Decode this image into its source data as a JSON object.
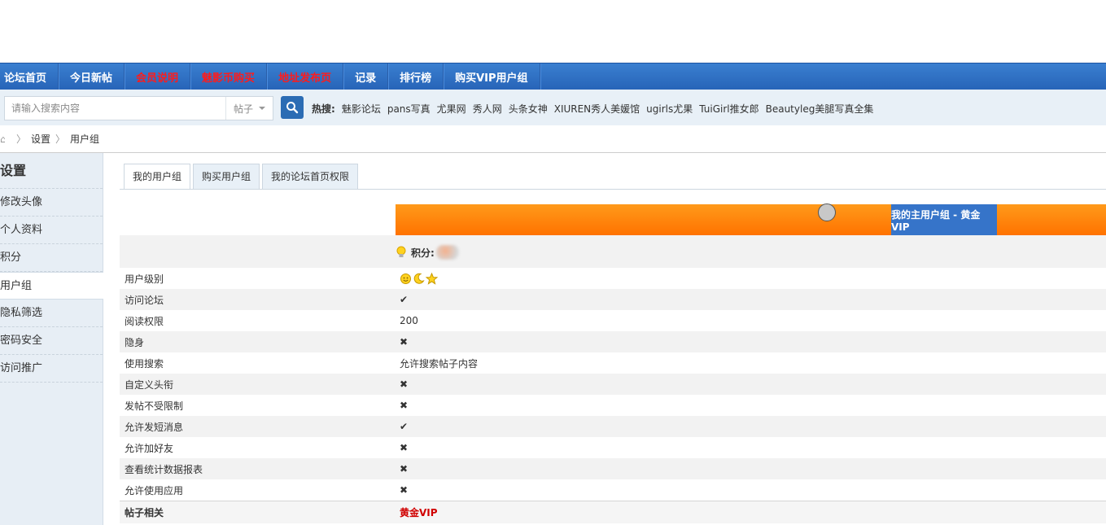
{
  "nav": {
    "items": [
      {
        "label": "论坛首页",
        "red": false
      },
      {
        "label": "今日新帖",
        "red": false
      },
      {
        "label": "会员说明",
        "red": true
      },
      {
        "label": "魅影币购买",
        "red": true
      },
      {
        "label": "地址发布页",
        "red": true
      },
      {
        "label": "记录",
        "red": false
      },
      {
        "label": "排行榜",
        "red": false
      },
      {
        "label": "购买VIP用户组",
        "red": false
      }
    ]
  },
  "search": {
    "placeholder": "请输入搜索内容",
    "type": "帖子",
    "hot_label": "热搜:",
    "hot_items": [
      "魅影论坛",
      "pans写真",
      "尤果网",
      "秀人网",
      "头条女神",
      "XIUREN秀人美媛馆",
      "ugirls尤果",
      "TuiGirl推女郎",
      "Beautyleg美腿写真全集"
    ]
  },
  "breadcrumb": {
    "items": [
      "设置",
      "用户组"
    ]
  },
  "sidebar": {
    "title": "设置",
    "items": [
      "修改头像",
      "个人资料",
      "积分",
      "用户组",
      "隐私筛选",
      "密码安全",
      "访问推广"
    ],
    "active_index": 3
  },
  "tabs": [
    "我的用户组",
    "购买用户组",
    "我的论坛首页权限"
  ],
  "group": {
    "name": "我的主用户组 - 黄金VIP",
    "score_label": "积分:"
  },
  "permissions": [
    {
      "label": "用户级别",
      "value": "",
      "type": "level"
    },
    {
      "label": "访问论坛",
      "value": "",
      "type": "yes"
    },
    {
      "label": "阅读权限",
      "value": "200",
      "type": "text"
    },
    {
      "label": "隐身",
      "value": "",
      "type": "no"
    },
    {
      "label": "使用搜索",
      "value": "允许搜索帖子内容",
      "type": "text"
    },
    {
      "label": "自定义头衔",
      "value": "",
      "type": "no"
    },
    {
      "label": "发帖不受限制",
      "value": "",
      "type": "no"
    },
    {
      "label": "允许发短消息",
      "value": "",
      "type": "yes"
    },
    {
      "label": "允许加好友",
      "value": "",
      "type": "no"
    },
    {
      "label": "查看统计数据报表",
      "value": "",
      "type": "no"
    },
    {
      "label": "允许使用应用",
      "value": "",
      "type": "no"
    }
  ],
  "footer_row": {
    "label": "帖子相关",
    "value": "黄金VIP"
  },
  "colors": {
    "nav_blue": "#2764b8",
    "accent_red": "#ff1b1b",
    "orange": "#ff7200",
    "check_green": "#4aa321",
    "cross_red": "#e8553b"
  }
}
